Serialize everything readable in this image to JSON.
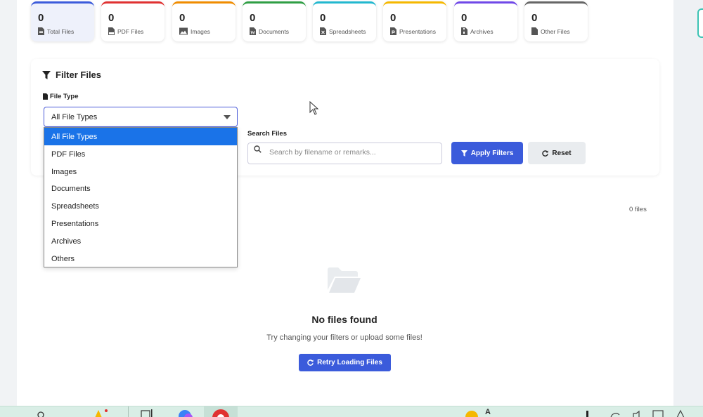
{
  "stats": [
    {
      "count": "0",
      "label": "Total Files",
      "icon": "file-icon",
      "color": "#3b5bdb",
      "active": true
    },
    {
      "count": "0",
      "label": "PDF Files",
      "icon": "pdf-file-icon",
      "color": "#e03131"
    },
    {
      "count": "0",
      "label": "Images",
      "icon": "image-icon",
      "color": "#f08c00"
    },
    {
      "count": "0",
      "label": "Documents",
      "icon": "word-file-icon",
      "color": "#2f9e44"
    },
    {
      "count": "0",
      "label": "Spreadsheets",
      "icon": "excel-file-icon",
      "color": "#22b8cf"
    },
    {
      "count": "0",
      "label": "Presentations",
      "icon": "powerpoint-file-icon",
      "color": "#f5b800"
    },
    {
      "count": "0",
      "label": "Archives",
      "icon": "archive-file-icon",
      "color": "#7048e8"
    },
    {
      "count": "0",
      "label": "Other Files",
      "icon": "file-icon",
      "color": "#666666"
    }
  ],
  "filter": {
    "title": "Filter Files",
    "file_type_label": "File Type",
    "selected": "All File Types",
    "options": [
      "All File Types",
      "PDF Files",
      "Images",
      "Documents",
      "Spreadsheets",
      "Presentations",
      "Archives",
      "Others"
    ],
    "search_label": "Search Files",
    "search_placeholder": "Search by filename or remarks...",
    "apply_label": "Apply Filters",
    "reset_label": "Reset"
  },
  "results": {
    "count_text": "0 files",
    "empty_title": "No files found",
    "empty_subtitle": "Try changing your filters or upload some files!",
    "retry_label": "Retry Loading Files"
  },
  "taskbar": {
    "tray_text": "A"
  },
  "colors": {
    "primary": "#3b5bdb",
    "selected_option": "#1a73e8"
  }
}
